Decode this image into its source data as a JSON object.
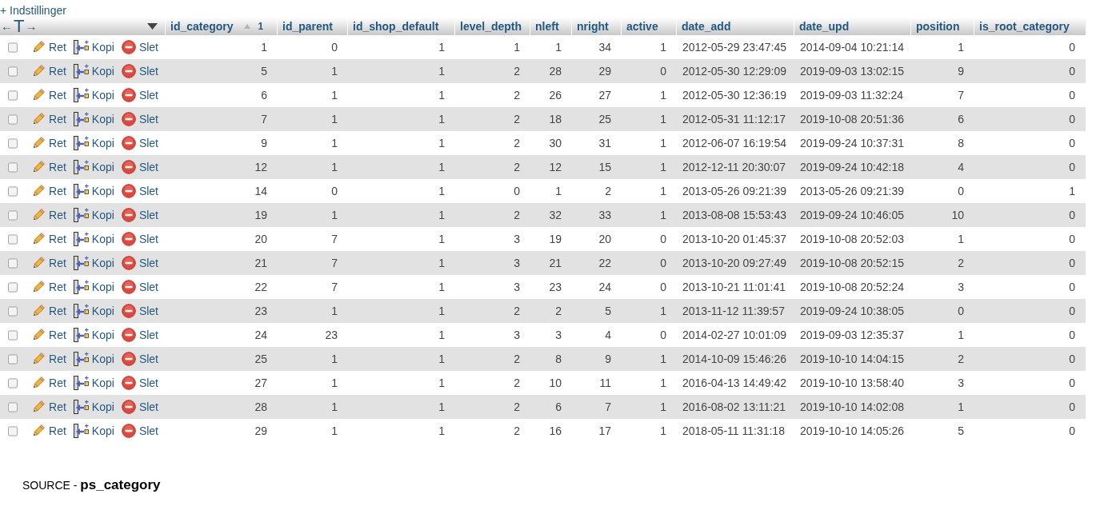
{
  "options_link": "+ Indstillinger",
  "table": {
    "full_text_toggle": "←T→",
    "columns": [
      {
        "label": "id_category",
        "kind": "number",
        "sorted": true,
        "sort_order": "1"
      },
      {
        "label": "id_parent",
        "kind": "number"
      },
      {
        "label": "id_shop_default",
        "kind": "number"
      },
      {
        "label": "level_depth",
        "kind": "number"
      },
      {
        "label": "nleft",
        "kind": "number"
      },
      {
        "label": "nright",
        "kind": "number"
      },
      {
        "label": "active",
        "kind": "number"
      },
      {
        "label": "date_add",
        "kind": "datetime"
      },
      {
        "label": "date_upd",
        "kind": "datetime"
      },
      {
        "label": "position",
        "kind": "number"
      },
      {
        "label": "is_root_category",
        "kind": "number"
      }
    ],
    "rows": [
      {
        "checked": false,
        "actions": [
          {
            "kind": "edit",
            "label": "Ret"
          },
          {
            "kind": "copy",
            "label": "Kopi"
          },
          {
            "kind": "delete",
            "label": "Slet"
          }
        ],
        "cells": [
          "1",
          "0",
          "1",
          "1",
          "1",
          "34",
          "1",
          "2012-05-29 23:47:45",
          "2014-09-04 10:21:14",
          "1",
          "0"
        ]
      },
      {
        "checked": false,
        "actions": [
          {
            "kind": "edit",
            "label": "Ret"
          },
          {
            "kind": "copy",
            "label": "Kopi"
          },
          {
            "kind": "delete",
            "label": "Slet"
          }
        ],
        "cells": [
          "5",
          "1",
          "1",
          "2",
          "28",
          "29",
          "0",
          "2012-05-30 12:29:09",
          "2019-09-03 13:02:15",
          "9",
          "0"
        ]
      },
      {
        "checked": false,
        "actions": [
          {
            "kind": "edit",
            "label": "Ret"
          },
          {
            "kind": "copy",
            "label": "Kopi"
          },
          {
            "kind": "delete",
            "label": "Slet"
          }
        ],
        "cells": [
          "6",
          "1",
          "1",
          "2",
          "26",
          "27",
          "1",
          "2012-05-30 12:36:19",
          "2019-09-03 11:32:24",
          "7",
          "0"
        ]
      },
      {
        "checked": false,
        "actions": [
          {
            "kind": "edit",
            "label": "Ret"
          },
          {
            "kind": "copy",
            "label": "Kopi"
          },
          {
            "kind": "delete",
            "label": "Slet"
          }
        ],
        "cells": [
          "7",
          "1",
          "1",
          "2",
          "18",
          "25",
          "1",
          "2012-05-31 11:12:17",
          "2019-10-08 20:51:36",
          "6",
          "0"
        ]
      },
      {
        "checked": false,
        "actions": [
          {
            "kind": "edit",
            "label": "Ret"
          },
          {
            "kind": "copy",
            "label": "Kopi"
          },
          {
            "kind": "delete",
            "label": "Slet"
          }
        ],
        "cells": [
          "9",
          "1",
          "1",
          "2",
          "30",
          "31",
          "1",
          "2012-06-07 16:19:54",
          "2019-09-24 10:37:31",
          "8",
          "0"
        ]
      },
      {
        "checked": false,
        "actions": [
          {
            "kind": "edit",
            "label": "Ret"
          },
          {
            "kind": "copy",
            "label": "Kopi"
          },
          {
            "kind": "delete",
            "label": "Slet"
          }
        ],
        "cells": [
          "12",
          "1",
          "1",
          "2",
          "12",
          "15",
          "1",
          "2012-12-11 20:30:07",
          "2019-09-24 10:42:18",
          "4",
          "0"
        ]
      },
      {
        "checked": false,
        "actions": [
          {
            "kind": "edit",
            "label": "Ret"
          },
          {
            "kind": "copy",
            "label": "Kopi"
          },
          {
            "kind": "delete",
            "label": "Slet"
          }
        ],
        "cells": [
          "14",
          "0",
          "1",
          "0",
          "1",
          "2",
          "1",
          "2013-05-26 09:21:39",
          "2013-05-26 09:21:39",
          "0",
          "1"
        ]
      },
      {
        "checked": false,
        "actions": [
          {
            "kind": "edit",
            "label": "Ret"
          },
          {
            "kind": "copy",
            "label": "Kopi"
          },
          {
            "kind": "delete",
            "label": "Slet"
          }
        ],
        "cells": [
          "19",
          "1",
          "1",
          "2",
          "32",
          "33",
          "1",
          "2013-08-08 15:53:43",
          "2019-09-24 10:46:05",
          "10",
          "0"
        ]
      },
      {
        "checked": false,
        "actions": [
          {
            "kind": "edit",
            "label": "Ret"
          },
          {
            "kind": "copy",
            "label": "Kopi"
          },
          {
            "kind": "delete",
            "label": "Slet"
          }
        ],
        "cells": [
          "20",
          "7",
          "1",
          "3",
          "19",
          "20",
          "0",
          "2013-10-20 01:45:37",
          "2019-10-08 20:52:03",
          "1",
          "0"
        ]
      },
      {
        "checked": false,
        "actions": [
          {
            "kind": "edit",
            "label": "Ret"
          },
          {
            "kind": "copy",
            "label": "Kopi"
          },
          {
            "kind": "delete",
            "label": "Slet"
          }
        ],
        "cells": [
          "21",
          "7",
          "1",
          "3",
          "21",
          "22",
          "0",
          "2013-10-20 09:27:49",
          "2019-10-08 20:52:15",
          "2",
          "0"
        ]
      },
      {
        "checked": false,
        "actions": [
          {
            "kind": "edit",
            "label": "Ret"
          },
          {
            "kind": "copy",
            "label": "Kopi"
          },
          {
            "kind": "delete",
            "label": "Slet"
          }
        ],
        "cells": [
          "22",
          "7",
          "1",
          "3",
          "23",
          "24",
          "0",
          "2013-10-21 11:01:41",
          "2019-10-08 20:52:24",
          "3",
          "0"
        ]
      },
      {
        "checked": false,
        "actions": [
          {
            "kind": "edit",
            "label": "Ret"
          },
          {
            "kind": "copy",
            "label": "Kopi"
          },
          {
            "kind": "delete",
            "label": "Slet"
          }
        ],
        "cells": [
          "23",
          "1",
          "1",
          "2",
          "2",
          "5",
          "1",
          "2013-11-12 11:39:57",
          "2019-09-24 10:38:05",
          "0",
          "0"
        ]
      },
      {
        "checked": false,
        "actions": [
          {
            "kind": "edit",
            "label": "Ret"
          },
          {
            "kind": "copy",
            "label": "Kopi"
          },
          {
            "kind": "delete",
            "label": "Slet"
          }
        ],
        "cells": [
          "24",
          "23",
          "1",
          "3",
          "3",
          "4",
          "0",
          "2014-02-27 10:01:09",
          "2019-09-03 12:35:37",
          "1",
          "0"
        ]
      },
      {
        "checked": false,
        "actions": [
          {
            "kind": "edit",
            "label": "Ret"
          },
          {
            "kind": "copy",
            "label": "Kopi"
          },
          {
            "kind": "delete",
            "label": "Slet"
          }
        ],
        "cells": [
          "25",
          "1",
          "1",
          "2",
          "8",
          "9",
          "1",
          "2014-10-09 15:46:26",
          "2019-10-10 14:04:15",
          "2",
          "0"
        ]
      },
      {
        "checked": false,
        "actions": [
          {
            "kind": "edit",
            "label": "Ret"
          },
          {
            "kind": "copy",
            "label": "Kopi"
          },
          {
            "kind": "delete",
            "label": "Slet"
          }
        ],
        "cells": [
          "27",
          "1",
          "1",
          "2",
          "10",
          "11",
          "1",
          "2016-04-13 14:49:42",
          "2019-10-10 13:58:40",
          "3",
          "0"
        ]
      },
      {
        "checked": false,
        "actions": [
          {
            "kind": "edit",
            "label": "Ret"
          },
          {
            "kind": "copy",
            "label": "Kopi"
          },
          {
            "kind": "delete",
            "label": "Slet"
          }
        ],
        "cells": [
          "28",
          "1",
          "1",
          "2",
          "6",
          "7",
          "1",
          "2016-08-02 13:11:21",
          "2019-10-10 14:02:08",
          "1",
          "0"
        ]
      },
      {
        "checked": false,
        "actions": [
          {
            "kind": "edit",
            "label": "Ret"
          },
          {
            "kind": "copy",
            "label": "Kopi"
          },
          {
            "kind": "delete",
            "label": "Slet"
          }
        ],
        "cells": [
          "29",
          "1",
          "1",
          "2",
          "16",
          "17",
          "1",
          "2018-05-11 11:31:18",
          "2019-10-10 14:05:26",
          "5",
          "0"
        ]
      }
    ]
  },
  "caption": "SOURCE - **ps_category**"
}
